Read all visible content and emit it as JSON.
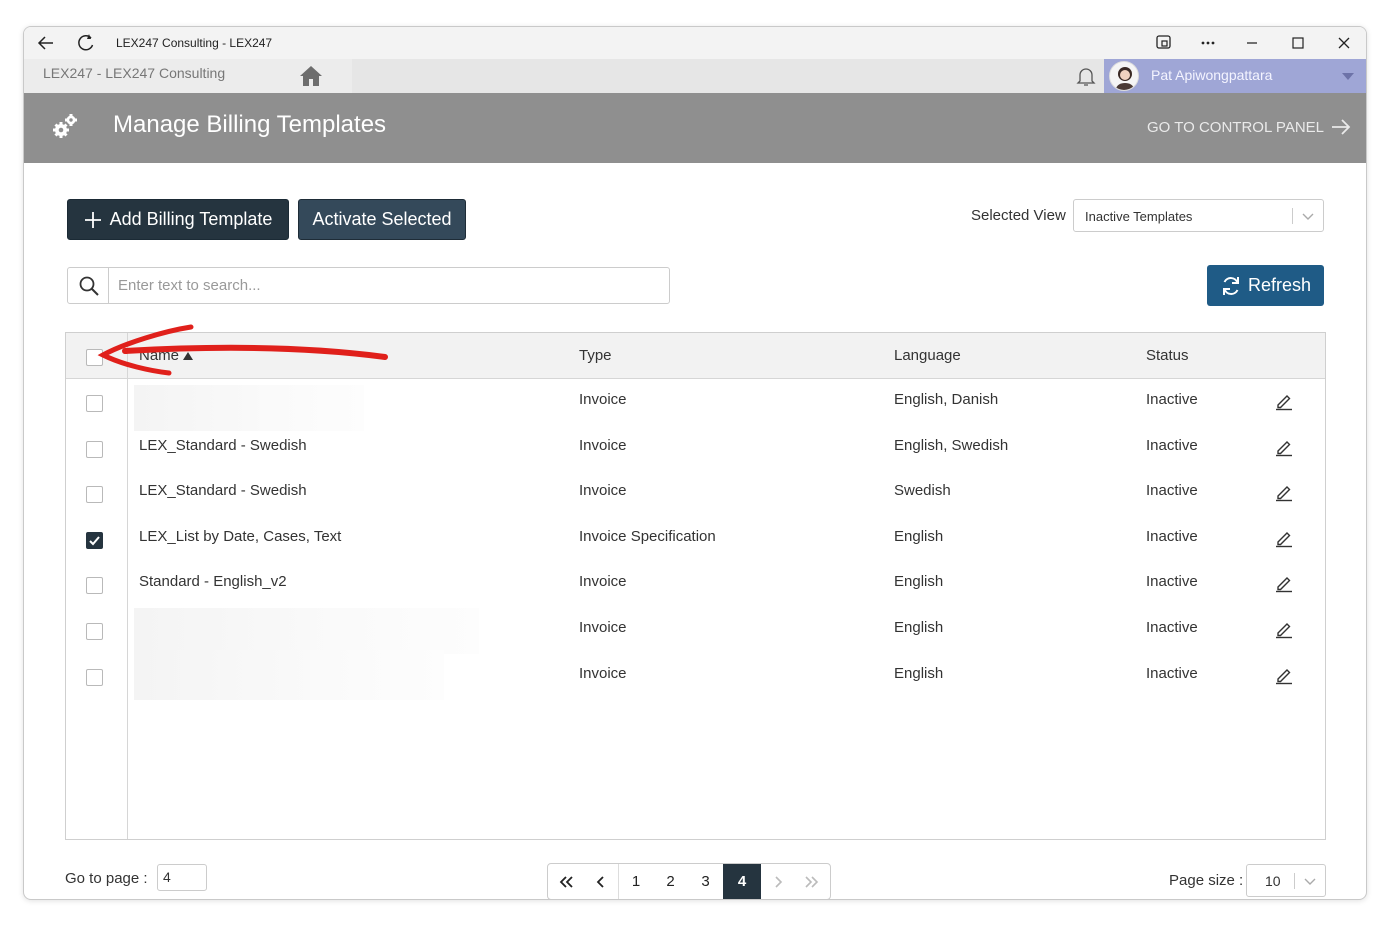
{
  "window": {
    "title": "LEX247 Consulting - LEX247"
  },
  "navbar": {
    "brand": "LEX247  -  LEX247 Consulting",
    "user_name": "Pat Apiwongpattara"
  },
  "header": {
    "title": "Manage Billing Templates",
    "control_panel_link": "GO TO CONTROL PANEL"
  },
  "toolbar": {
    "add_label": "Add Billing Template",
    "activate_label": "Activate Selected",
    "selected_view_label": "Selected View",
    "selected_view_value": "Inactive Templates",
    "search_placeholder": "Enter text to search...",
    "refresh_label": "Refresh"
  },
  "grid": {
    "columns": [
      "Name",
      "Type",
      "Language",
      "Status"
    ],
    "sort_column": "Name",
    "rows": [
      {
        "name": "",
        "type": "Invoice",
        "language": "English, Danish",
        "status": "Inactive",
        "checked": false,
        "redacted": true
      },
      {
        "name": "LEX_Standard - Swedish",
        "type": "Invoice",
        "language": "English, Swedish",
        "status": "Inactive",
        "checked": false
      },
      {
        "name": "LEX_Standard - Swedish",
        "type": "Invoice",
        "language": "Swedish",
        "status": "Inactive",
        "checked": false
      },
      {
        "name": "LEX_List by Date, Cases, Text",
        "type": "Invoice Specification",
        "language": "English",
        "status": "Inactive",
        "checked": true
      },
      {
        "name": "Standard - English_v2",
        "type": "Invoice",
        "language": "English",
        "status": "Inactive",
        "checked": false
      },
      {
        "name": "",
        "type": "Invoice",
        "language": "English",
        "status": "Inactive",
        "checked": false,
        "redacted": true
      },
      {
        "name": "",
        "type": "Invoice",
        "language": "English",
        "status": "Inactive",
        "checked": false,
        "redacted": true
      }
    ]
  },
  "pagination": {
    "goto_label": "Go to page :",
    "goto_value": "4",
    "pages": [
      "1",
      "2",
      "3",
      "4"
    ],
    "current_page": "4",
    "page_size_label": "Page size :",
    "page_size_value": "10"
  },
  "colors": {
    "dark_button": "#25343f",
    "refresh_button": "#1f5b86",
    "header_bg": "#8f8f8f",
    "user_bg": "#9fa6d6",
    "annotation": "#e0201b"
  }
}
